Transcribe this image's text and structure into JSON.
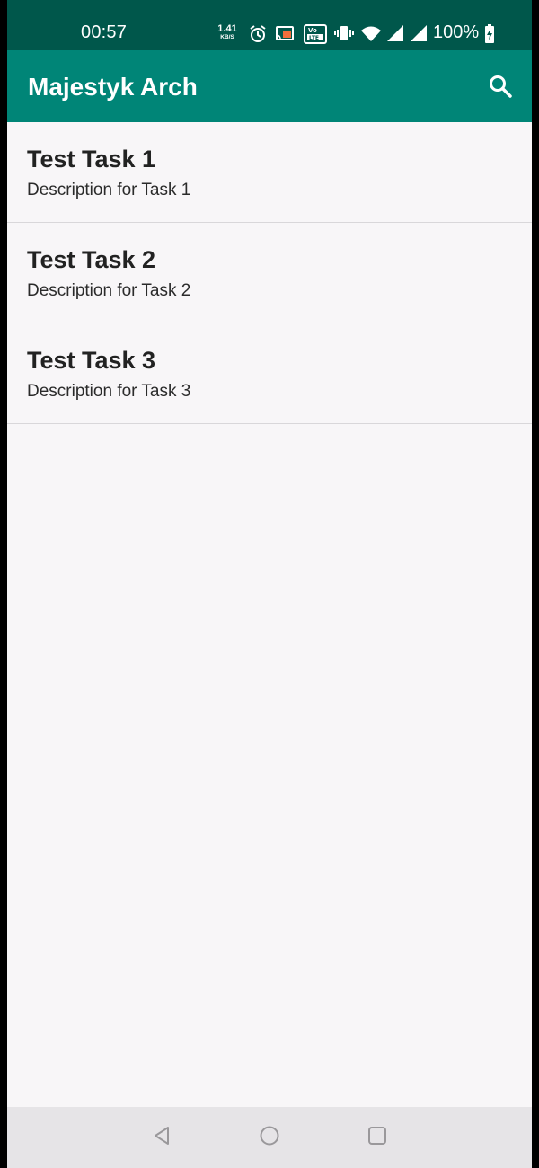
{
  "status_bar": {
    "time": "00:57",
    "net_speed_value": "1.41",
    "net_speed_unit": "KB/S",
    "battery_percent": "100%",
    "icons": [
      "alarm-icon",
      "cast-icon",
      "volte-icon",
      "vibrate-icon",
      "wifi-icon",
      "signal-icon",
      "signal-icon-2",
      "battery-charging-icon"
    ]
  },
  "app_bar": {
    "title": "Majestyk Arch",
    "search_icon": "search-icon"
  },
  "tasks": [
    {
      "title": "Test Task 1",
      "description": "Description for Task 1"
    },
    {
      "title": "Test Task 2",
      "description": "Description for Task 2"
    },
    {
      "title": "Test Task 3",
      "description": "Description for Task 3"
    }
  ],
  "nav_bar": {
    "icons": [
      "back-icon",
      "home-icon",
      "recents-icon"
    ]
  },
  "colors": {
    "status_bar": "#00574b",
    "app_bar": "#008577",
    "background": "#f8f6f8",
    "nav_bar": "#e6e4e7",
    "divider": "#d9d7da"
  }
}
